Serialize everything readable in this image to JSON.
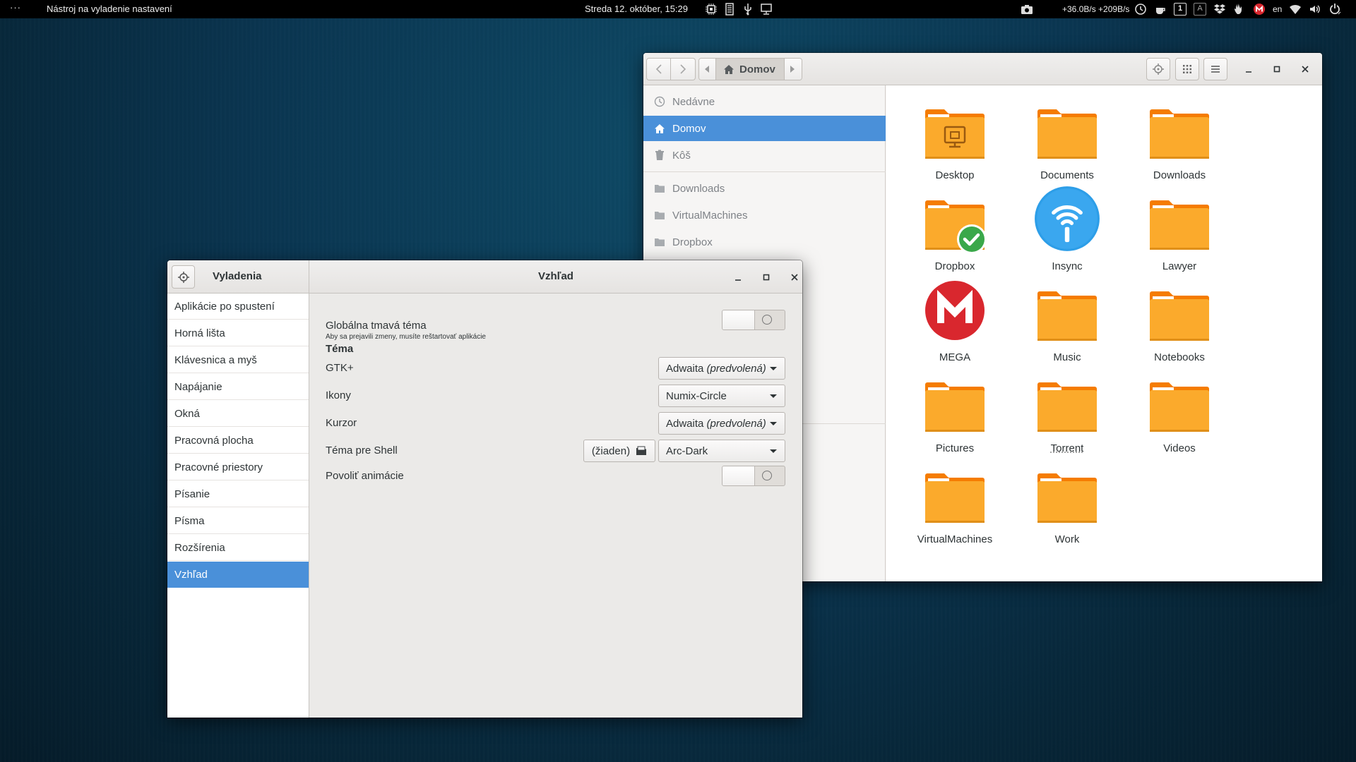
{
  "topbar": {
    "activities": "···",
    "app_menu": "Nástroj na vyladenie nastavení",
    "clock": "Streda 12. október, 15:29",
    "net_speed": "+36.0B/s +209B/s",
    "keyboard_layout": "en",
    "indicator_1": "1",
    "indicator_a": "A"
  },
  "files_window": {
    "path_current": "Domov",
    "sidebar": [
      {
        "label": "Nedávne",
        "icon": "clock-icon"
      },
      {
        "label": "Domov",
        "icon": "home-icon",
        "selected": true
      },
      {
        "label": "Kôš",
        "icon": "trash-icon"
      },
      {
        "label": "Downloads",
        "icon": "folder-icon"
      },
      {
        "label": "VirtualMachines",
        "icon": "folder-icon"
      },
      {
        "label": "Dropbox",
        "icon": "folder-icon"
      }
    ],
    "items": [
      {
        "label": "Desktop",
        "icon": "desktop-folder-icon"
      },
      {
        "label": "Documents",
        "icon": "folder-icon"
      },
      {
        "label": "Downloads",
        "icon": "folder-icon"
      },
      {
        "label": "Dropbox",
        "icon": "dropbox-folder-icon"
      },
      {
        "label": "Insync",
        "icon": "insync-icon"
      },
      {
        "label": "Lawyer",
        "icon": "folder-icon"
      },
      {
        "label": "MEGA",
        "icon": "mega-icon"
      },
      {
        "label": "Music",
        "icon": "folder-icon"
      },
      {
        "label": "Notebooks",
        "icon": "folder-icon"
      },
      {
        "label": "Pictures",
        "icon": "folder-icon"
      },
      {
        "label": "Torrent",
        "icon": "folder-icon"
      },
      {
        "label": "Videos",
        "icon": "folder-icon"
      },
      {
        "label": "VirtualMachines",
        "icon": "folder-icon"
      },
      {
        "label": "Work",
        "icon": "folder-icon"
      }
    ],
    "colors": {
      "folder": "#fbaa2c",
      "folder_tab": "#f57c00",
      "selection": "#4a90d9"
    }
  },
  "tweaks_window": {
    "app_title": "Vyladenia",
    "page_title": "Vzhľad",
    "sidebar": [
      "Aplikácie po spustení",
      "Horná lišta",
      "Klávesnica a myš",
      "Napájanie",
      "Okná",
      "Pracovná plocha",
      "Pracovné priestory",
      "Písanie",
      "Písma",
      "Rozšírenia",
      "Vzhľad"
    ],
    "selected_item": "Vzhľad",
    "global_dark": {
      "label": "Globálna tmavá téma",
      "note": "Aby sa prejavili zmeny, musíte reštartovať aplikácie",
      "state": "off"
    },
    "theme_heading": "Téma",
    "gtk": {
      "label": "GTK+",
      "value": "Adwaita",
      "suffix": "(predvolená)"
    },
    "icons": {
      "label": "Ikony",
      "value": "Numix-Circle"
    },
    "cursor": {
      "label": "Kurzor",
      "value": "Adwaita",
      "suffix": "(predvolená)"
    },
    "shell": {
      "label": "Téma pre Shell",
      "file_button": "(žiaden)",
      "value": "Arc-Dark"
    },
    "animations": {
      "label": "Povoliť animácie",
      "state": "off"
    }
  }
}
